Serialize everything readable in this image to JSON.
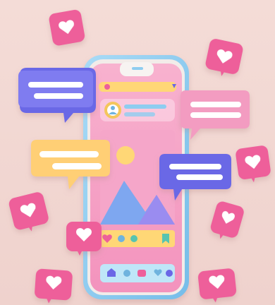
{
  "illustration": {
    "subject": "social-media-phone",
    "colors": {
      "background": "#f2d9d4",
      "phone_body": "#8ecdf0",
      "phone_frame_dark": "#6fb3de",
      "screen": "#f6a3c7",
      "header_bar": "#ffd776",
      "profile_bar": "#f4c65c",
      "mountain_blue": "#7ea7f0",
      "mountain_purple": "#9a8cf0",
      "sun": "#ffd776",
      "heart_tile": "#ee5f9a",
      "heart_tile_dark": "#d84a84",
      "heart": "#ffffff",
      "bubble_purple": "#6b67e6",
      "bubble_pink": "#f7a9c7",
      "bubble_yellow": "#ffd98a",
      "bubble_line": "#ffffff"
    },
    "icons": [
      "heart-icon",
      "comment-bubble-icon",
      "home-icon",
      "search-icon",
      "profile-icon",
      "camera-icon",
      "heart-outline-icon"
    ]
  }
}
